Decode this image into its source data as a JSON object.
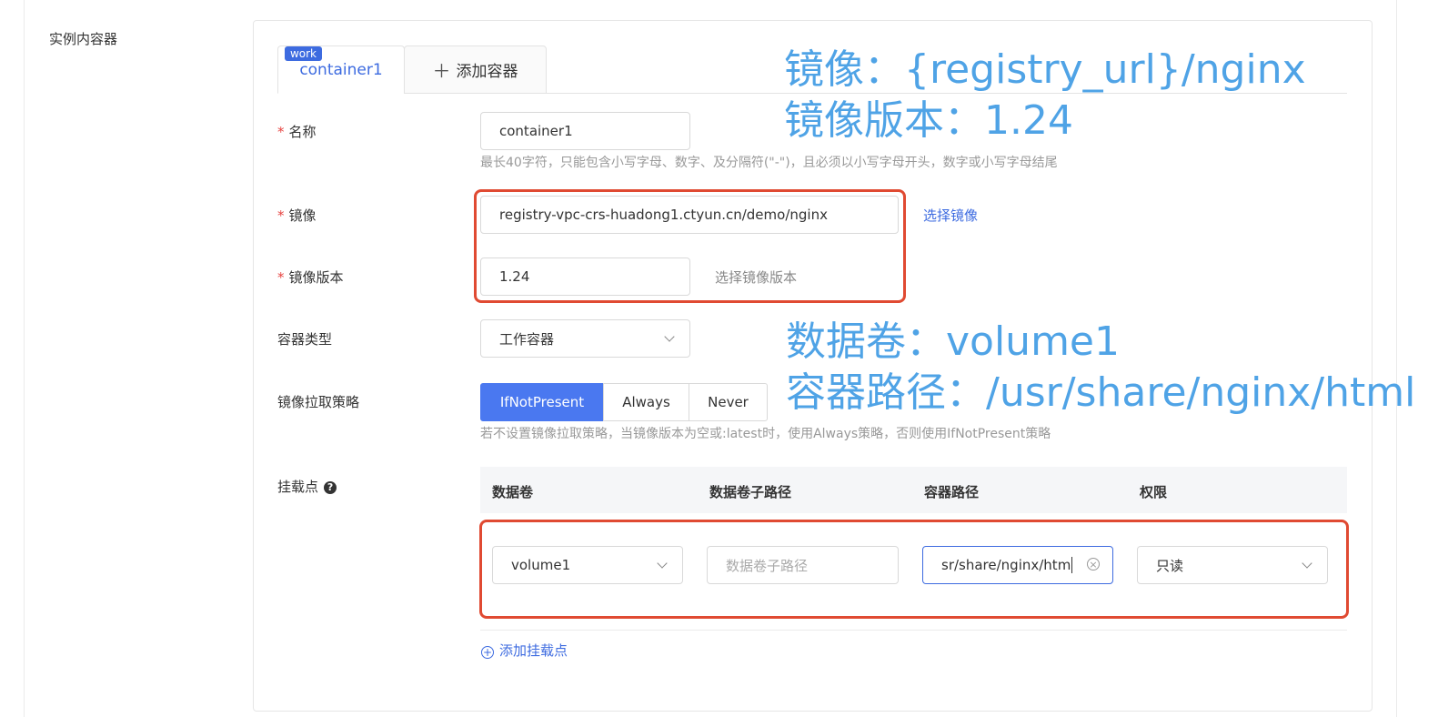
{
  "section_label": "实例内容器",
  "tabs": {
    "active_label": "container1",
    "active_badge": "work",
    "add_label": "添加容器",
    "add_symbol": "＋"
  },
  "fields": {
    "name": {
      "label": "名称",
      "required": "*",
      "value": "container1",
      "hint": "最长40字符，只能包含小写字母、数字、及分隔符(\"-\")，且必须以小写字母开头，数字或小写字母结尾"
    },
    "image": {
      "label": "镜像",
      "required": "*",
      "value": "registry-vpc-crs-huadong1.ctyun.cn/demo/nginx",
      "action": "选择镜像"
    },
    "image_version": {
      "label": "镜像版本",
      "required": "*",
      "value": "1.24",
      "action": "选择镜像版本"
    },
    "container_type": {
      "label": "容器类型",
      "value": "工作容器"
    },
    "pull_policy": {
      "label": "镜像拉取策略",
      "options": [
        "IfNotPresent",
        "Always",
        "Never"
      ],
      "selected": "IfNotPresent",
      "hint": "若不设置镜像拉取策略，当镜像版本为空或:latest时，使用Always策略，否则使用IfNotPresent策略"
    },
    "mount": {
      "label": "挂载点",
      "help": "?"
    }
  },
  "mount_table": {
    "columns": [
      "数据卷",
      "数据卷子路径",
      "容器路径",
      "权限"
    ],
    "row": {
      "volume": "volume1",
      "subpath_placeholder": "数据卷子路径",
      "container_path": "sr/share/nginx/htm",
      "permission": "只读"
    },
    "add_label": "添加挂载点",
    "add_symbol": "+"
  },
  "annotations": {
    "image": "镜像：{registry_url}/nginx",
    "version": "镜像版本：1.24",
    "volume": "数据卷：volume1",
    "path": "容器路径：/usr/share/nginx/html"
  },
  "colors": {
    "primary": "#3d6be0",
    "segment_active": "#4a78f0",
    "highlight_box": "#e04a32",
    "annotation": "#4fa3e6",
    "required": "#e64340"
  },
  "icons": {
    "clear": "×",
    "help": "?"
  }
}
